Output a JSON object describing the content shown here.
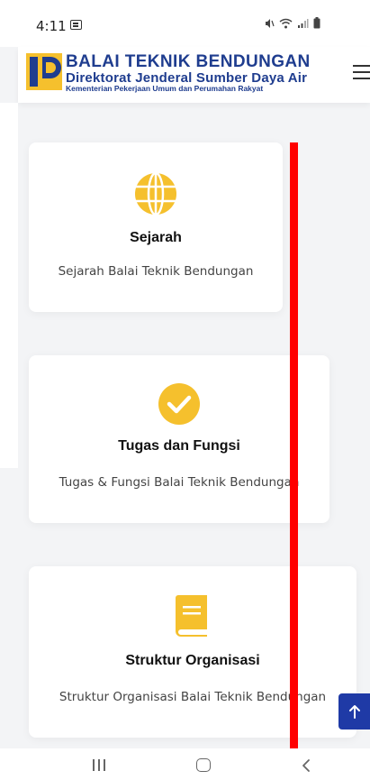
{
  "status_bar": {
    "time": "4:11"
  },
  "header": {
    "title": "BALAI TEKNIK BENDUNGAN",
    "subtitle": "Direktorat Jenderal Sumber Daya Air",
    "ministry": "Kementerian Pekerjaan Umum dan Perumahan Rakyat"
  },
  "cards": [
    {
      "icon": "globe-icon",
      "title": "Sejarah",
      "description": "Sejarah Balai Teknik Bendungan"
    },
    {
      "icon": "check-circle-icon",
      "title": "Tugas dan Fungsi",
      "description": "Tugas & Fungsi Balai Teknik Bendungan"
    },
    {
      "icon": "book-icon",
      "title": "Struktur Organisasi",
      "description": "Struktur Organisasi Balai Teknik Bendungan"
    }
  ],
  "colors": {
    "brand": "#1f3d8f",
    "accent": "#f5c02d",
    "scroll_button": "#1f3aa6",
    "overlay_line": "#ff0000"
  }
}
